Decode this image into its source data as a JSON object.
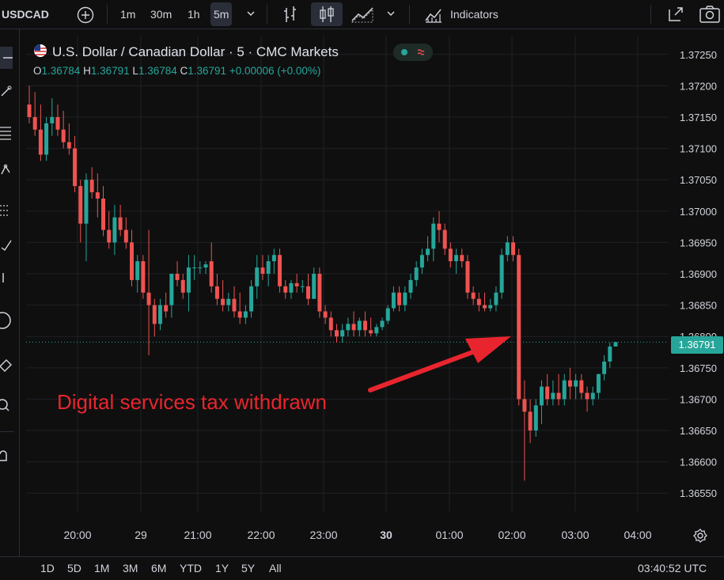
{
  "toolbar": {
    "symbol": "USDCAD",
    "timeframes": [
      "1m",
      "30m",
      "1h",
      "5m"
    ],
    "active_timeframe": "5m",
    "indicators_label": "Indicators"
  },
  "legend": {
    "title": "U.S. Dollar / Canadian Dollar · 5 · CMC Markets",
    "ohlc": {
      "o_label": "O",
      "o": "1.36784",
      "h_label": "H",
      "h": "1.36791",
      "l_label": "L",
      "l": "1.36784",
      "c_label": "C",
      "c": "1.36791",
      "change": "+0.00006 (+0.00%)"
    }
  },
  "annotation": {
    "text": "Digital services tax withdrawn",
    "color": "#e8252e"
  },
  "price_axis": {
    "labels": [
      "1.37250",
      "1.37200",
      "1.37150",
      "1.37100",
      "1.37050",
      "1.37000",
      "1.36950",
      "1.36900",
      "1.36850",
      "1.36800",
      "1.36750",
      "1.36700",
      "1.36650",
      "1.36600",
      "1.36550"
    ],
    "current_price": "1.36791"
  },
  "time_axis": {
    "labels": [
      "20:00",
      "29",
      "21:00",
      "22:00",
      "23:00",
      "30",
      "01:00",
      "02:00",
      "03:00",
      "04:00"
    ]
  },
  "bottom_bar": {
    "ranges": [
      "1D",
      "5D",
      "1M",
      "3M",
      "6M",
      "YTD",
      "1Y",
      "5Y",
      "All"
    ],
    "clock": "03:40:52 UTC"
  },
  "colors": {
    "up": "#26a69a",
    "down": "#ef5350",
    "background": "#0f0f0f",
    "grid": "#1e2026"
  },
  "chart_data": {
    "type": "candlestick",
    "ylim": [
      1.3652,
      1.3728
    ],
    "ticks": [
      "20:00",
      "29",
      "21:00",
      "22:00",
      "23:00",
      "30",
      "01:00",
      "02:00",
      "03:00",
      "04:00"
    ],
    "candles": [
      [
        1.3717,
        1.372,
        1.3714,
        1.3715
      ],
      [
        1.3715,
        1.3719,
        1.3712,
        1.3713
      ],
      [
        1.3713,
        1.3717,
        1.3708,
        1.3709
      ],
      [
        1.3709,
        1.3715,
        1.3708,
        1.3714
      ],
      [
        1.3714,
        1.3718,
        1.3712,
        1.3715
      ],
      [
        1.3715,
        1.3717,
        1.3712,
        1.3713
      ],
      [
        1.3713,
        1.3716,
        1.371,
        1.3711
      ],
      [
        1.3711,
        1.3714,
        1.3709,
        1.371
      ],
      [
        1.371,
        1.3712,
        1.3703,
        1.3704
      ],
      [
        1.3704,
        1.3705,
        1.3695,
        1.3698
      ],
      [
        1.3698,
        1.3706,
        1.3692,
        1.3705
      ],
      [
        1.3705,
        1.3707,
        1.3702,
        1.3703
      ],
      [
        1.3703,
        1.3706,
        1.3699,
        1.3702
      ],
      [
        1.3702,
        1.3704,
        1.3696,
        1.3697
      ],
      [
        1.3697,
        1.37,
        1.3694,
        1.3695
      ],
      [
        1.3695,
        1.3701,
        1.3693,
        1.3699
      ],
      [
        1.3699,
        1.3701,
        1.3696,
        1.3697
      ],
      [
        1.3697,
        1.3699,
        1.3694,
        1.3695
      ],
      [
        1.3695,
        1.3697,
        1.3688,
        1.3689
      ],
      [
        1.3689,
        1.3693,
        1.3687,
        1.3692
      ],
      [
        1.3692,
        1.3693,
        1.3686,
        1.3687
      ],
      [
        1.3687,
        1.3697,
        1.3677,
        1.3685
      ],
      [
        1.3685,
        1.3686,
        1.368,
        1.3682
      ],
      [
        1.3682,
        1.3686,
        1.3681,
        1.3685
      ],
      [
        1.3685,
        1.3687,
        1.3683,
        1.3684
      ],
      [
        1.3685,
        1.369,
        1.3683,
        1.369
      ],
      [
        1.369,
        1.3692,
        1.3688,
        1.3689
      ],
      [
        1.3689,
        1.369,
        1.3686,
        1.3687
      ],
      [
        1.3687,
        1.3693,
        1.3684,
        1.3691
      ],
      [
        1.3691,
        1.3693,
        1.3689,
        1.3691
      ],
      [
        1.3691,
        1.3692,
        1.369,
        1.3691
      ],
      [
        1.3691,
        1.3692,
        1.369,
        1.36915
      ],
      [
        1.3692,
        1.3695,
        1.3687,
        1.3688
      ],
      [
        1.3688,
        1.369,
        1.3685,
        1.3686
      ],
      [
        1.3686,
        1.3689,
        1.3684,
        1.3685
      ],
      [
        1.3685,
        1.3687,
        1.3684,
        1.3686
      ],
      [
        1.3686,
        1.3688,
        1.3683,
        1.3684
      ],
      [
        1.3684,
        1.3687,
        1.3682,
        1.3683
      ],
      [
        1.3683,
        1.3685,
        1.3682,
        1.3684
      ],
      [
        1.3684,
        1.3689,
        1.3683,
        1.3688
      ],
      [
        1.3688,
        1.3693,
        1.3686,
        1.3691
      ],
      [
        1.3691,
        1.3693,
        1.3689,
        1.369
      ],
      [
        1.369,
        1.3693,
        1.3688,
        1.3692
      ],
      [
        1.3692,
        1.3694,
        1.369,
        1.3693
      ],
      [
        1.3693,
        1.3694,
        1.3687,
        1.3688
      ],
      [
        1.3688,
        1.3689,
        1.3686,
        1.3687
      ],
      [
        1.3687,
        1.3689,
        1.3686,
        1.36885
      ],
      [
        1.36885,
        1.369,
        1.3687,
        1.3688
      ],
      [
        1.3688,
        1.3689,
        1.3687,
        1.3688
      ],
      [
        1.3688,
        1.369,
        1.3685,
        1.3686
      ],
      [
        1.3686,
        1.3691,
        1.3686,
        1.369
      ],
      [
        1.369,
        1.3691,
        1.3683,
        1.3684
      ],
      [
        1.3684,
        1.3685,
        1.3682,
        1.3683
      ],
      [
        1.3683,
        1.3684,
        1.368,
        1.3681
      ],
      [
        1.3681,
        1.3682,
        1.3679,
        1.368
      ],
      [
        1.368,
        1.3682,
        1.3679,
        1.3681
      ],
      [
        1.3681,
        1.3683,
        1.368,
        1.3682
      ],
      [
        1.3682,
        1.3684,
        1.368,
        1.3681
      ],
      [
        1.3681,
        1.3683,
        1.368,
        1.36825
      ],
      [
        1.36825,
        1.3684,
        1.368,
        1.3681
      ],
      [
        1.3681,
        1.3683,
        1.368,
        1.36805
      ],
      [
        1.36805,
        1.3682,
        1.368,
        1.36815
      ],
      [
        1.36815,
        1.3683,
        1.3681,
        1.36825
      ],
      [
        1.36825,
        1.3685,
        1.3682,
        1.36845
      ],
      [
        1.36845,
        1.3688,
        1.3684,
        1.3687
      ],
      [
        1.3687,
        1.3688,
        1.3684,
        1.3685
      ],
      [
        1.3685,
        1.3688,
        1.3684,
        1.3687
      ],
      [
        1.3687,
        1.369,
        1.3686,
        1.3689
      ],
      [
        1.3689,
        1.3692,
        1.3688,
        1.3691
      ],
      [
        1.3691,
        1.3694,
        1.369,
        1.3693
      ],
      [
        1.3693,
        1.3696,
        1.3692,
        1.3694
      ],
      [
        1.3694,
        1.3699,
        1.3692,
        1.3698
      ],
      [
        1.3698,
        1.37,
        1.3695,
        1.3697
      ],
      [
        1.3697,
        1.3698,
        1.3693,
        1.3694
      ],
      [
        1.3694,
        1.3695,
        1.3691,
        1.3692
      ],
      [
        1.3692,
        1.3694,
        1.369,
        1.3693
      ],
      [
        1.3693,
        1.3694,
        1.3691,
        1.3692
      ],
      [
        1.3692,
        1.3693,
        1.3686,
        1.3687
      ],
      [
        1.3687,
        1.3688,
        1.3685,
        1.3686
      ],
      [
        1.3686,
        1.3687,
        1.3684,
        1.3685
      ],
      [
        1.3685,
        1.3687,
        1.3684,
        1.36845
      ],
      [
        1.36845,
        1.3686,
        1.3684,
        1.3685
      ],
      [
        1.3685,
        1.3688,
        1.3684,
        1.3687
      ],
      [
        1.3687,
        1.3694,
        1.3686,
        1.3693
      ],
      [
        1.3693,
        1.3696,
        1.3692,
        1.3695
      ],
      [
        1.3695,
        1.3696,
        1.3692,
        1.3693
      ],
      [
        1.3693,
        1.3694,
        1.3669,
        1.367
      ],
      [
        1.367,
        1.3673,
        1.3657,
        1.3668
      ],
      [
        1.3668,
        1.367,
        1.3663,
        1.3665
      ],
      [
        1.3665,
        1.367,
        1.3664,
        1.3669
      ],
      [
        1.3669,
        1.3673,
        1.3666,
        1.3672
      ],
      [
        1.3672,
        1.3674,
        1.3669,
        1.367
      ],
      [
        1.367,
        1.3673,
        1.3669,
        1.3671
      ],
      [
        1.3671,
        1.3674,
        1.3669,
        1.367
      ],
      [
        1.367,
        1.3674,
        1.3669,
        1.3673
      ],
      [
        1.3673,
        1.3675,
        1.367,
        1.3672
      ],
      [
        1.3672,
        1.3674,
        1.367,
        1.3673
      ],
      [
        1.3673,
        1.3674,
        1.367,
        1.3671
      ],
      [
        1.3671,
        1.3672,
        1.3668,
        1.367
      ],
      [
        1.367,
        1.3672,
        1.3669,
        1.3671
      ],
      [
        1.3671,
        1.3674,
        1.367,
        1.3674
      ],
      [
        1.3674,
        1.3677,
        1.3673,
        1.3676
      ],
      [
        1.3676,
        1.3679,
        1.3675,
        1.36784
      ],
      [
        1.36784,
        1.36791,
        1.36784,
        1.36791
      ]
    ]
  }
}
